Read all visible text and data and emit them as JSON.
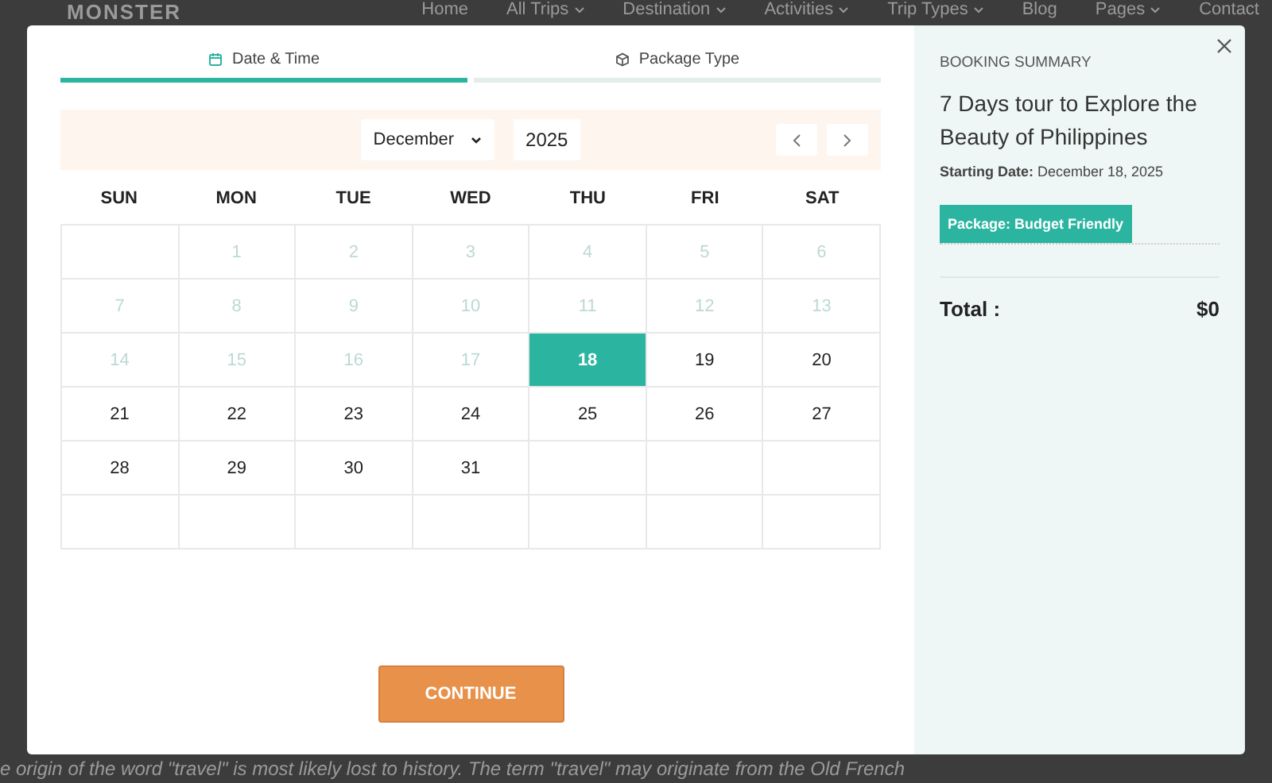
{
  "site": {
    "logo": "MONSTER",
    "nav": [
      {
        "label": "Home",
        "dropdown": false
      },
      {
        "label": "All Trips",
        "dropdown": true
      },
      {
        "label": "Destination",
        "dropdown": true
      },
      {
        "label": "Activities",
        "dropdown": true
      },
      {
        "label": "Trip Types",
        "dropdown": true
      },
      {
        "label": "Blog",
        "dropdown": false
      },
      {
        "label": "Pages",
        "dropdown": true
      },
      {
        "label": "Contact",
        "dropdown": false
      }
    ],
    "body_text": "e origin of the word \"travel\" is most likely lost to history. The term \"travel\" may originate from the Old French"
  },
  "modal": {
    "tabs": [
      {
        "label": "Date & Time",
        "selected": true
      },
      {
        "label": "Package Type",
        "selected": false
      }
    ],
    "calendar": {
      "month": "December",
      "year": "2025",
      "weekdays": [
        "SUN",
        "MON",
        "TUE",
        "WED",
        "THU",
        "FRI",
        "SAT"
      ],
      "weeks": [
        [
          {
            "kind": "blank"
          },
          {
            "kind": "day",
            "label": "1",
            "disabled": true,
            "selected": false
          },
          {
            "kind": "day",
            "label": "2",
            "disabled": true,
            "selected": false
          },
          {
            "kind": "day",
            "label": "3",
            "disabled": true,
            "selected": false
          },
          {
            "kind": "day",
            "label": "4",
            "disabled": true,
            "selected": false
          },
          {
            "kind": "day",
            "label": "5",
            "disabled": true,
            "selected": false
          },
          {
            "kind": "day",
            "label": "6",
            "disabled": true,
            "selected": false
          }
        ],
        [
          {
            "kind": "day",
            "label": "7",
            "disabled": true,
            "selected": false
          },
          {
            "kind": "day",
            "label": "8",
            "disabled": true,
            "selected": false
          },
          {
            "kind": "day",
            "label": "9",
            "disabled": true,
            "selected": false
          },
          {
            "kind": "day",
            "label": "10",
            "disabled": true,
            "selected": false
          },
          {
            "kind": "day",
            "label": "11",
            "disabled": true,
            "selected": false
          },
          {
            "kind": "day",
            "label": "12",
            "disabled": true,
            "selected": false
          },
          {
            "kind": "day",
            "label": "13",
            "disabled": true,
            "selected": false
          }
        ],
        [
          {
            "kind": "day",
            "label": "14",
            "disabled": true,
            "selected": false
          },
          {
            "kind": "day",
            "label": "15",
            "disabled": true,
            "selected": false
          },
          {
            "kind": "day",
            "label": "16",
            "disabled": true,
            "selected": false
          },
          {
            "kind": "day",
            "label": "17",
            "disabled": true,
            "selected": false
          },
          {
            "kind": "day",
            "label": "18",
            "disabled": false,
            "selected": true
          },
          {
            "kind": "day",
            "label": "19",
            "disabled": false,
            "selected": false
          },
          {
            "kind": "day",
            "label": "20",
            "disabled": false,
            "selected": false
          }
        ],
        [
          {
            "kind": "day",
            "label": "21",
            "disabled": false,
            "selected": false
          },
          {
            "kind": "day",
            "label": "22",
            "disabled": false,
            "selected": false
          },
          {
            "kind": "day",
            "label": "23",
            "disabled": false,
            "selected": false
          },
          {
            "kind": "day",
            "label": "24",
            "disabled": false,
            "selected": false
          },
          {
            "kind": "day",
            "label": "25",
            "disabled": false,
            "selected": false
          },
          {
            "kind": "day",
            "label": "26",
            "disabled": false,
            "selected": false
          },
          {
            "kind": "day",
            "label": "27",
            "disabled": false,
            "selected": false
          }
        ],
        [
          {
            "kind": "day",
            "label": "28",
            "disabled": false,
            "selected": false
          },
          {
            "kind": "day",
            "label": "29",
            "disabled": false,
            "selected": false
          },
          {
            "kind": "day",
            "label": "30",
            "disabled": false,
            "selected": false
          },
          {
            "kind": "day",
            "label": "31",
            "disabled": false,
            "selected": false
          },
          {
            "kind": "blank"
          },
          {
            "kind": "blank"
          },
          {
            "kind": "blank"
          }
        ],
        [
          {
            "kind": "blank"
          },
          {
            "kind": "blank"
          },
          {
            "kind": "blank"
          },
          {
            "kind": "blank"
          },
          {
            "kind": "blank"
          },
          {
            "kind": "blank"
          },
          {
            "kind": "blank"
          }
        ]
      ]
    },
    "continue_button": "CONTINUE",
    "summary": {
      "heading": "BOOKING SUMMARY",
      "title": "7 Days tour to Explore the Beauty of Philippines",
      "starting_date": "**Starting Date:** December 18, 2025",
      "package": "Package: Budget Friendly",
      "total_label": "Total :",
      "total_value": "$0"
    }
  }
}
